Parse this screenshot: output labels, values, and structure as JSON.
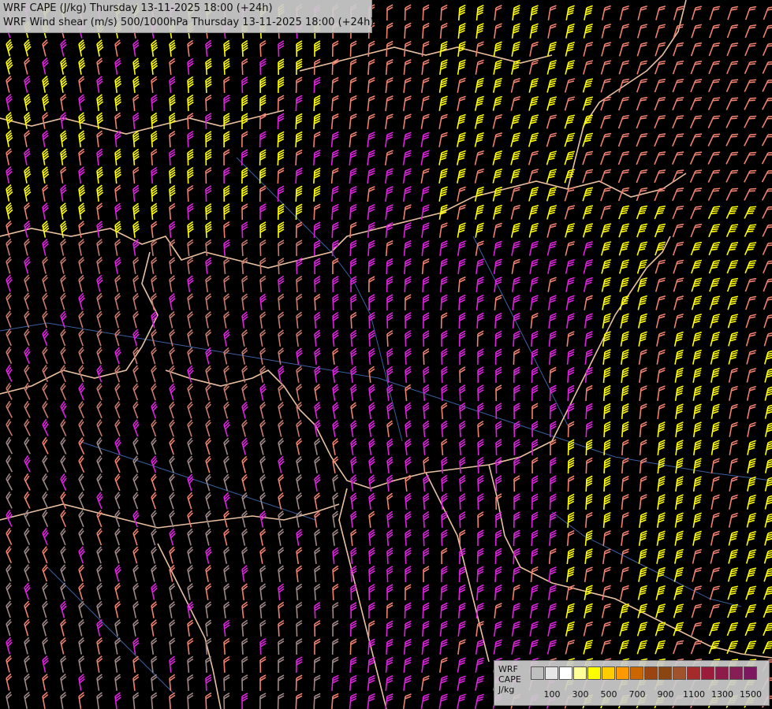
{
  "header": {
    "line1": "WRF CAPE (J/kg) Thursday 13-11-2025 18:00 (+24h)",
    "line2": "WRF Wind shear (m/s) 500/1000hPa Thursday 13-11-2025 18:00 (+24h)"
  },
  "legend": {
    "title_line1": "WRF",
    "title_line2": "CAPE",
    "title_line3": "J/kg",
    "colors": [
      "#bfbfbf",
      "#e6e6e6",
      "#ffffff",
      "#ffff99",
      "#ffff00",
      "#ffcc00",
      "#ff9900",
      "#cc6600",
      "#994411",
      "#8b4513",
      "#a0522d",
      "#a52a2a",
      "#9b1c3a",
      "#8e1a4a",
      "#861d55",
      "#7d1860",
      "#74105f",
      "#6b0a5c",
      "#620060",
      "#58005a",
      "#4e0055"
    ],
    "ticks": [
      {
        "label": "100",
        "index": 1
      },
      {
        "label": "300",
        "index": 3
      },
      {
        "label": "500",
        "index": 5
      },
      {
        "label": "700",
        "index": 7
      },
      {
        "label": "900",
        "index": 9
      },
      {
        "label": "1100",
        "index": 11
      },
      {
        "label": "1300",
        "index": 13
      },
      {
        "label": "1500",
        "index": 15
      }
    ]
  },
  "map": {
    "barb_colors": {
      "yellow": "#ffff00",
      "salmon": "#f08070",
      "magenta": "#dd22dd",
      "tan": "#c87a6e",
      "gray": "#a08888"
    },
    "border_color": "#e8c0a0",
    "river_color": "#3a5fa0",
    "background": "#000000"
  }
}
